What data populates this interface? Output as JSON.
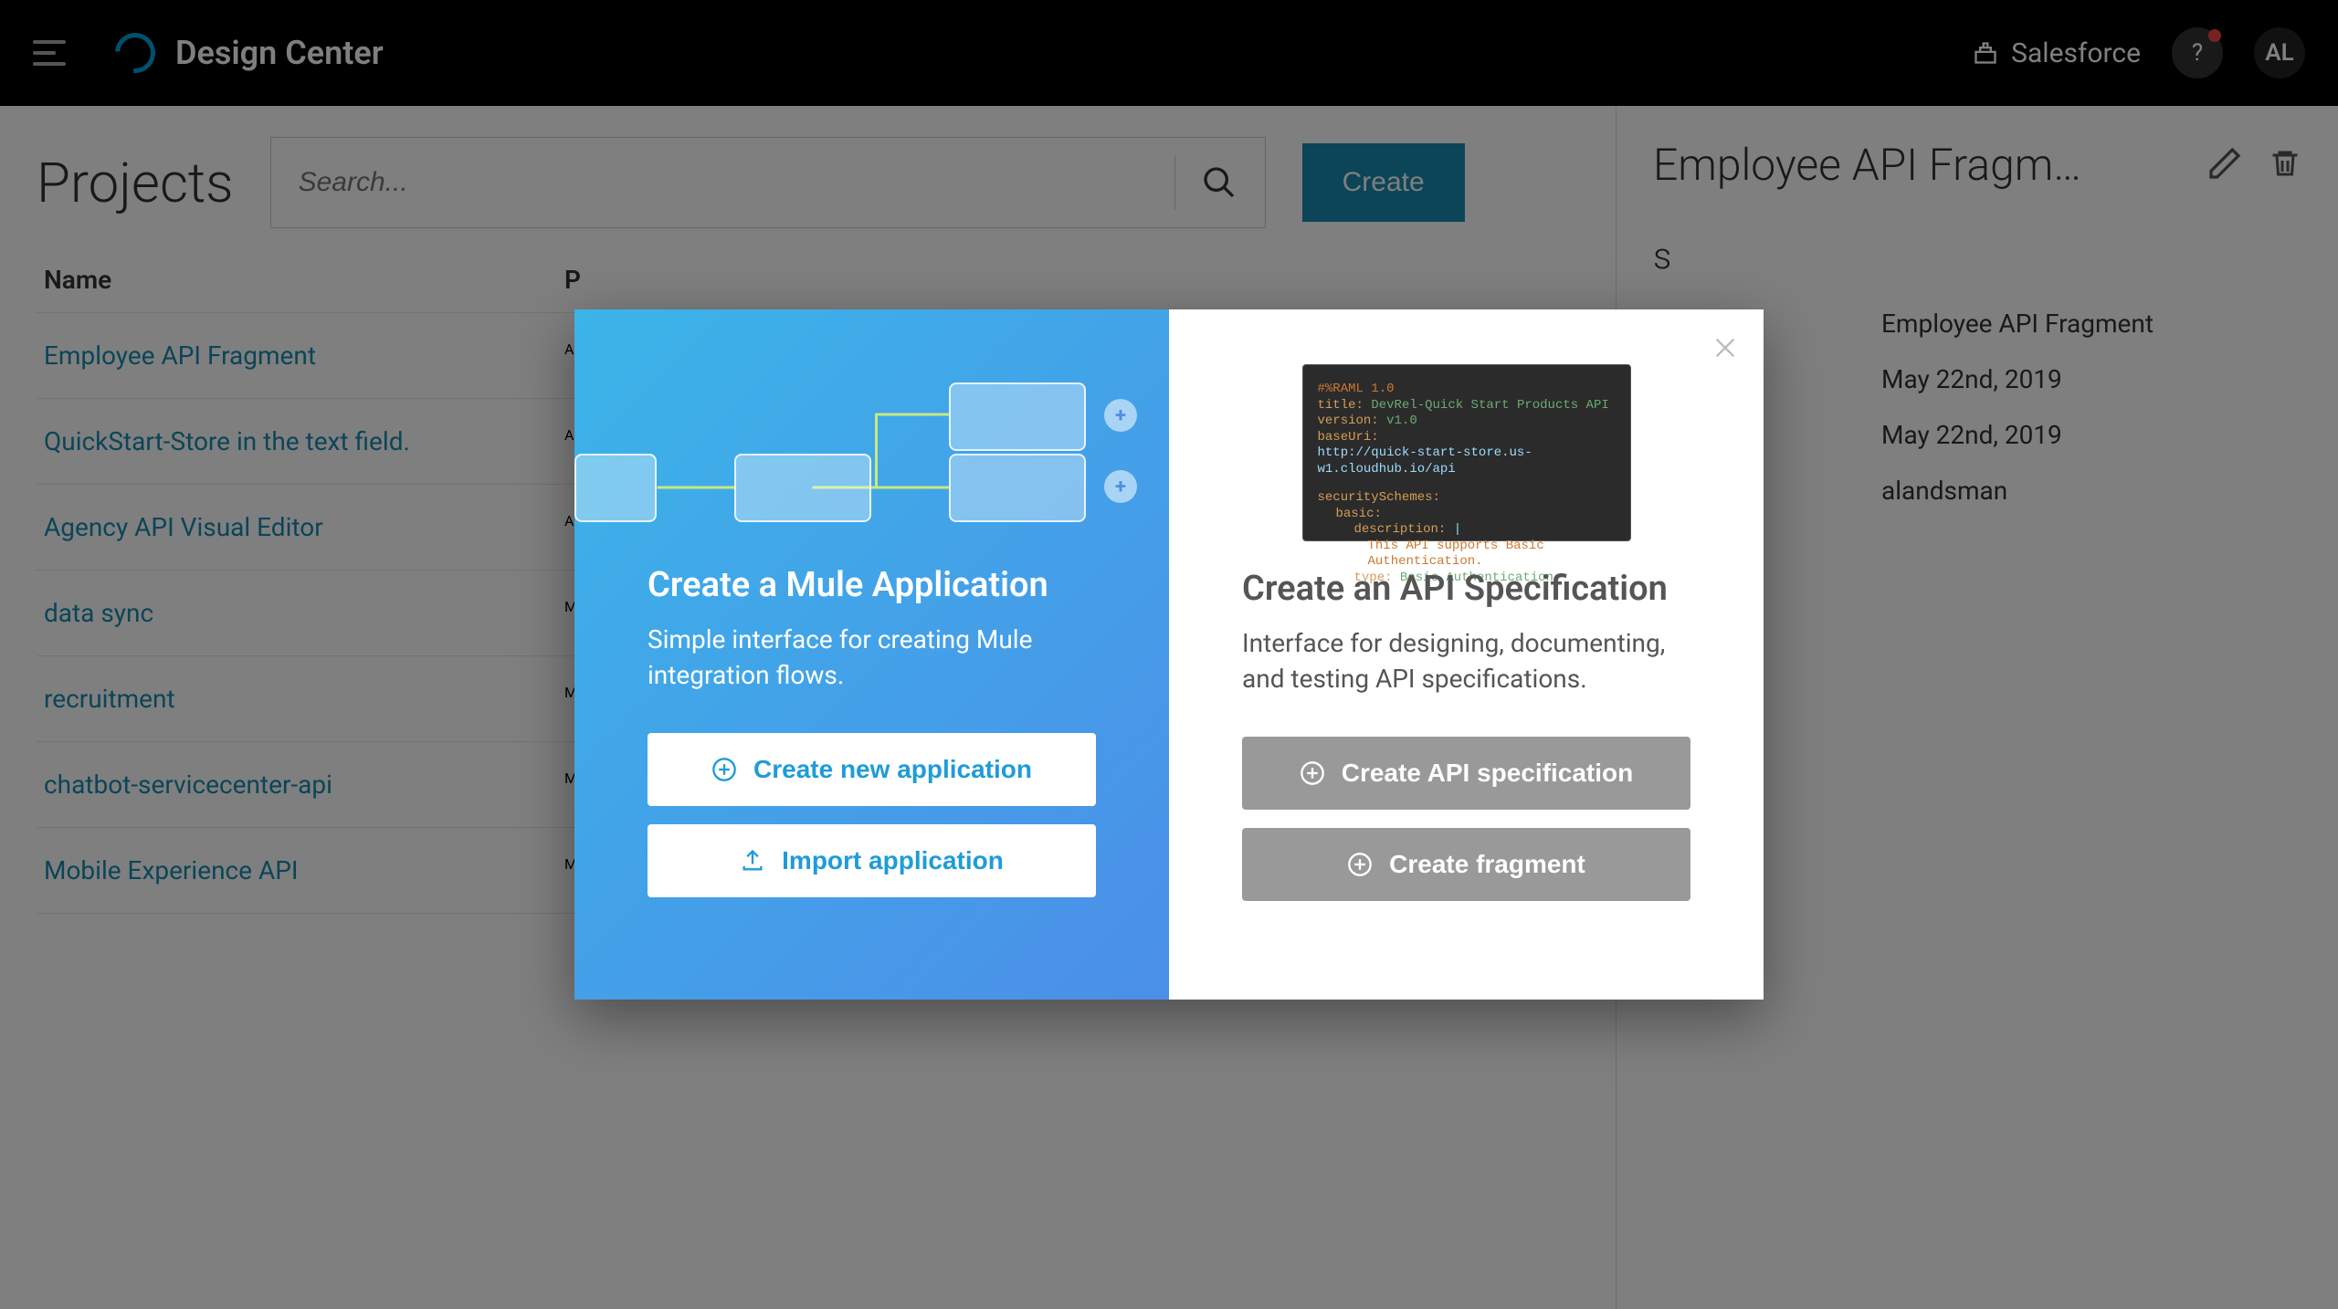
{
  "header": {
    "app_name": "Design Center",
    "salesforce": "Salesforce",
    "help": "?",
    "avatar": "AL"
  },
  "main": {
    "title": "Projects",
    "search_placeholder": "Search...",
    "create": "Create",
    "columns": {
      "name": "Name",
      "project": "P"
    },
    "rows": [
      {
        "name": "Employee API Fragment",
        "type": "A"
      },
      {
        "name": "QuickStart-Store in the text field.",
        "type": "A"
      },
      {
        "name": "Agency API Visual Editor",
        "type": "A"
      },
      {
        "name": "data sync",
        "type": "M"
      },
      {
        "name": "recruitment",
        "type": "M"
      },
      {
        "name": "chatbot-servicecenter-api",
        "type": "M"
      },
      {
        "name": "Mobile Experience API",
        "type": "M"
      }
    ]
  },
  "sidebar": {
    "title": "Employee API Fragm…",
    "section": "s",
    "meta": [
      {
        "label": "",
        "value": "Employee API Fragment"
      },
      {
        "label": "",
        "value": "May 22nd, 2019"
      },
      {
        "label": "",
        "value": "May 22nd, 2019"
      },
      {
        "label": "",
        "value": "alandsman"
      }
    ]
  },
  "modal": {
    "left": {
      "title": "Create a Mule Application",
      "desc": "Simple interface for creating Mule integration flows.",
      "btn_new": "Create new application",
      "btn_import": "Import application"
    },
    "right": {
      "title": "Create an API Specification",
      "desc": "Interface for designing, documenting, and testing API specifications.",
      "btn_spec": "Create API specification",
      "btn_frag": "Create fragment",
      "code": {
        "l1a": "#%RAML 1.0",
        "l2a": "title:",
        "l2b": " DevRel-Quick Start Products API",
        "l3a": "version:",
        "l3b": " v1.0",
        "l4a": "baseUri:",
        "l5": "http://quick-start-store.us-w1.cloudhub.io/api",
        "l6a": "securitySchemes:",
        "l7a": "basic:",
        "l8a": "description:",
        "l8b": " |",
        "l9": "This API supports Basic Authentication.",
        "l10a": "type:",
        "l10b": " Basic Authentication"
      }
    }
  }
}
